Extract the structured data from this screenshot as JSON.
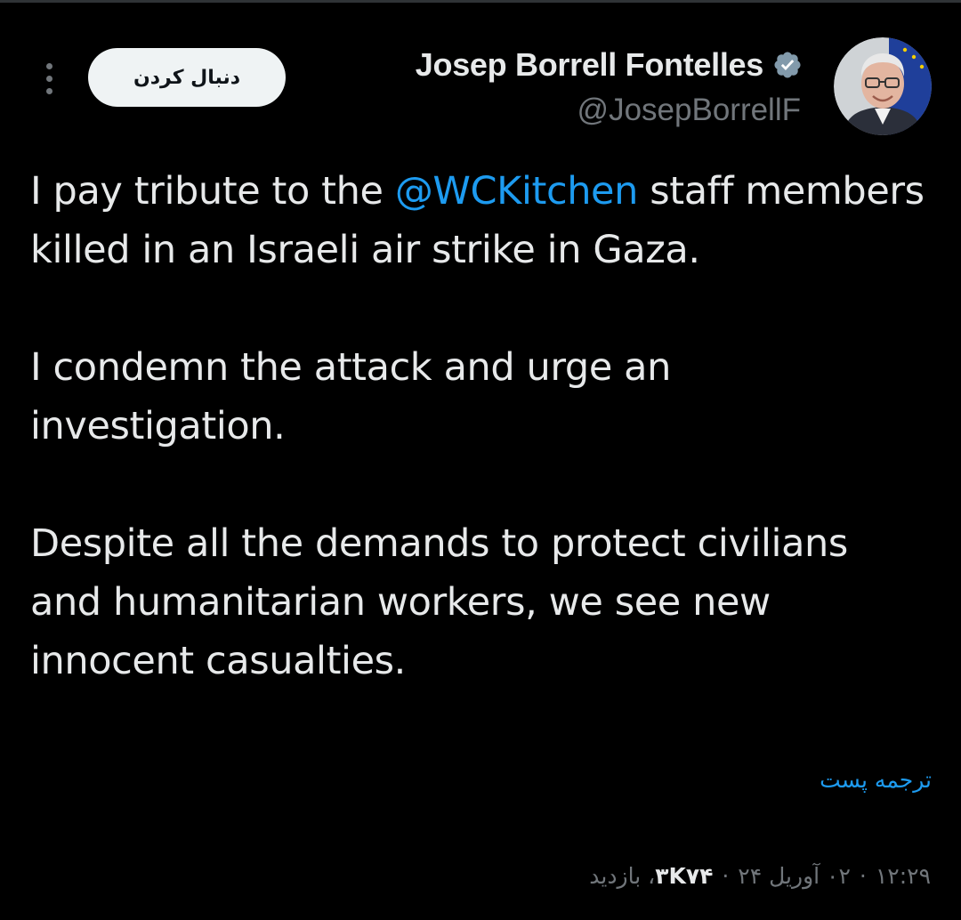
{
  "header": {
    "follow_label": "دنبال کردن",
    "display_name": "Josep Borrell Fontelles",
    "handle": "@JosepBorrellF",
    "verified_icon": "verified-badge-icon",
    "more_icon": "more-vertical-icon"
  },
  "tweet": {
    "p1_before": "I pay tribute to the ",
    "p1_mention": "@WCKitchen",
    "p1_after": " staff members killed in an Israeli air strike in Gaza.",
    "p2": "I condemn the attack and urge an investigation.",
    "p3": "Despite all the demands to protect civilians and humanitarian workers, we see new innocent casualties."
  },
  "translate_label": "ترجمه پست",
  "meta": {
    "time": "۱۲:۲۹",
    "date": "۰۲ آوریل ۲۴",
    "views_count": "۳K۷۴",
    "views_label": "بازدید"
  },
  "colors": {
    "background": "#000000",
    "text": "#e7e9ea",
    "muted": "#71767b",
    "accent": "#1d9bf0",
    "button_bg": "#eff3f4"
  }
}
